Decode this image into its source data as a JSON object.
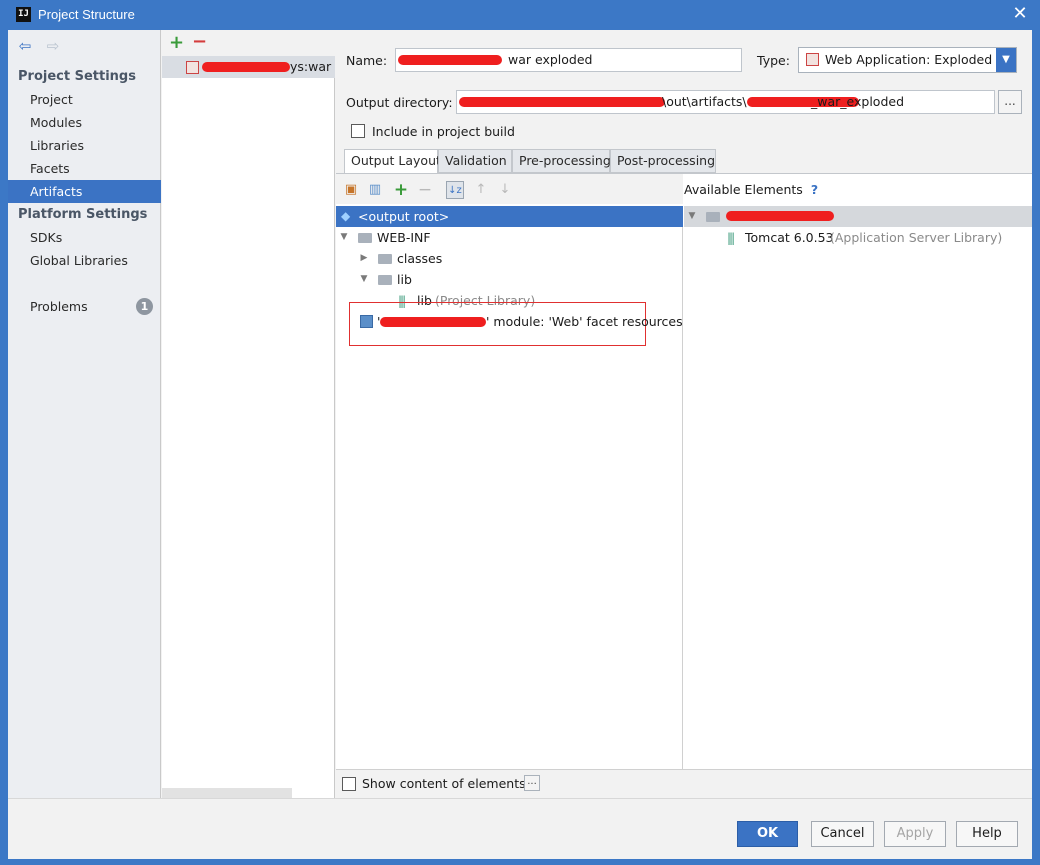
{
  "window": {
    "title": "Project Structure",
    "app_icon": "IJ",
    "close_glyph": "✕"
  },
  "nav": {
    "back_glyph": "⇦",
    "forward_glyph": "⇨",
    "project_settings_header": "Project Settings",
    "project_items": [
      "Project",
      "Modules",
      "Libraries",
      "Facets",
      "Artifacts"
    ],
    "selected": "Artifacts",
    "platform_settings_header": "Platform Settings",
    "platform_items": [
      "SDKs",
      "Global Libraries"
    ],
    "problems_label": "Problems",
    "problems_count": "1"
  },
  "artifacts_list": {
    "add_glyph": "+",
    "remove_glyph": "−",
    "items": [
      {
        "label": "ys:war"
      }
    ]
  },
  "editor": {
    "name_label": "Name:",
    "name_value": "war exploded",
    "type_label": "Type:",
    "type_value": "Web Application: Exploded",
    "output_dir_label": "Output directory:",
    "output_dir_value": "\\out\\artifacts\\",
    "output_dir_suffix": "_war_exploded",
    "browse_glyph": "...",
    "include_build_label": "Include in project build",
    "include_build_checked": false,
    "tabs": [
      "Output Layout",
      "Validation",
      "Pre-processing",
      "Post-processing"
    ],
    "active_tab": "Output Layout"
  },
  "layout_tree": {
    "nodes": [
      {
        "label": "<output root>",
        "selected": true
      },
      {
        "label": "WEB-INF"
      },
      {
        "label": "classes"
      },
      {
        "label": "lib"
      },
      {
        "label": "lib",
        "extra": "(Project Library)"
      },
      {
        "label": "' module: 'Web' facet resources"
      }
    ]
  },
  "available": {
    "title": "Available Elements",
    "help_glyph": "?",
    "items": [
      {
        "label": "Tomcat 6.0.53",
        "extra": "(Application Server Library)"
      }
    ]
  },
  "show_content_label": "Show content of elements",
  "show_content_checked": false,
  "footer": {
    "ok": "OK",
    "cancel": "Cancel",
    "apply": "Apply",
    "help": "Help"
  },
  "colors": {
    "accent": "#3b73c4",
    "titlebar": "#3c78c6",
    "highlight_box": "#e03030",
    "redaction": "#ef1f1f"
  }
}
